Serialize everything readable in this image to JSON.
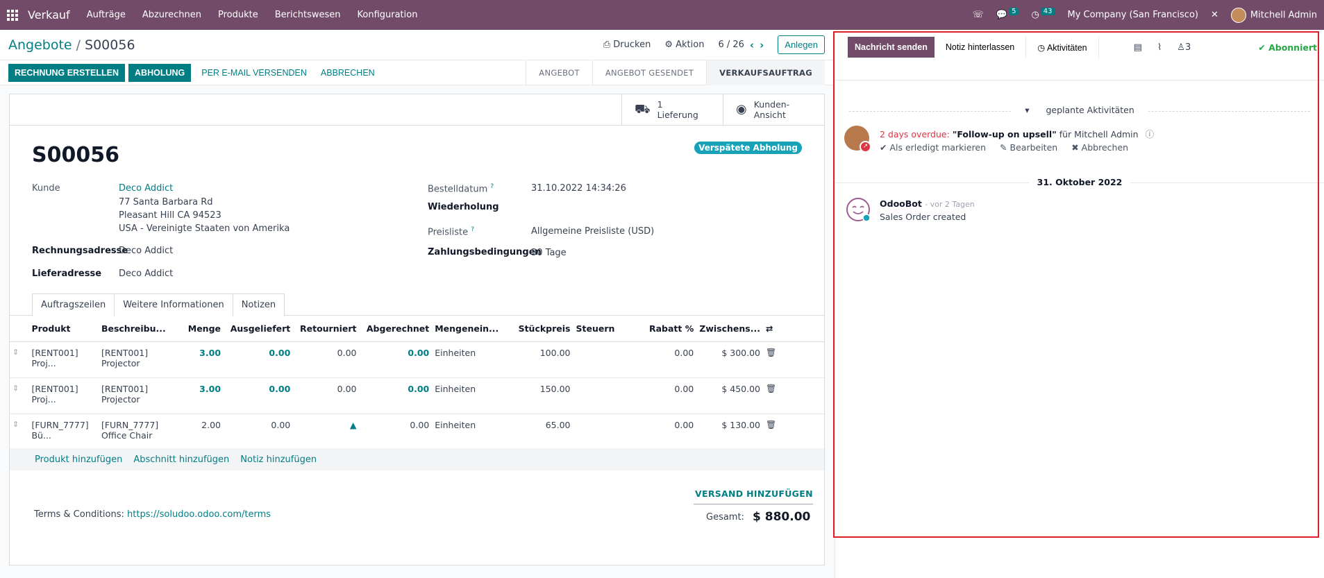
{
  "topnav": {
    "app_name": "Verkauf",
    "menu": [
      "Aufträge",
      "Abzurechnen",
      "Produkte",
      "Berichtswesen",
      "Konfiguration"
    ],
    "messages_count": "5",
    "activities_count": "43",
    "company": "My Company (San Francisco)",
    "user": "Mitchell Admin"
  },
  "control_panel": {
    "breadcrumb_parent": "Angebote",
    "breadcrumb_sep": "/",
    "breadcrumb_current": "S00056",
    "print": "Drucken",
    "action": "Aktion",
    "pager": "6 / 26",
    "new": "Anlegen"
  },
  "statusbar": {
    "buttons": {
      "invoice": "RECHNUNG ERSTELLEN",
      "pickup": "ABHOLUNG",
      "email": "PER E-MAIL VERSENDEN",
      "cancel": "ABBRECHEN"
    },
    "stages": [
      "ANGEBOT",
      "ANGEBOT GESENDET",
      "VERKAUFSAUFTRAG"
    ]
  },
  "smart_buttons": {
    "delivery_count": "1",
    "delivery_label": "Lieferung",
    "portal_line1": "Kunden-",
    "portal_line2": "Ansicht"
  },
  "order": {
    "name": "S00056",
    "late_badge": "Verspätete Abholung",
    "customer_label": "Kunde",
    "customer": "Deco Addict",
    "address1": "77 Santa Barbara Rd",
    "address2": "Pleasant Hill CA 94523",
    "address3": "USA - Vereinigte Staaten von Amerika",
    "invoice_addr_label": "Rechnungsadresse",
    "invoice_addr": "Deco Addict",
    "delivery_addr_label": "Lieferadresse",
    "delivery_addr": "Deco Addict",
    "order_date_label": "Bestelldatum",
    "order_date": "31.10.2022 14:34:26",
    "recurrence_label": "Wiederholung",
    "pricelist_label": "Preisliste",
    "pricelist": "Allgemeine Preisliste (USD)",
    "payment_terms_label": "Zahlungsbedingungen",
    "payment_terms": "30 Tage",
    "help_mark": "?"
  },
  "tabs": [
    "Auftragszeilen",
    "Weitere Informationen",
    "Notizen"
  ],
  "lines": {
    "headers": [
      "Produkt",
      "Beschreibu...",
      "Menge",
      "Ausgeliefert",
      "Retourniert",
      "Abgerechnet",
      "Mengenein...",
      "Stückpreis",
      "Steuern",
      "Rabatt %",
      "Zwischens..."
    ],
    "rows": [
      {
        "product": "[RENT001] Proj...",
        "desc1": "[RENT001]",
        "desc2": "Projector",
        "qty": "3.00",
        "delivered": "0.00",
        "returned": "0.00",
        "invoiced": "0.00",
        "uom": "Einheiten",
        "price": "100.00",
        "taxes": "",
        "discount": "0.00",
        "subtotal": "$ 300.00"
      },
      {
        "product": "[RENT001] Proj...",
        "desc1": "[RENT001]",
        "desc2": "Projector",
        "qty": "3.00",
        "delivered": "0.00",
        "returned": "0.00",
        "invoiced": "0.00",
        "uom": "Einheiten",
        "price": "150.00",
        "taxes": "",
        "discount": "0.00",
        "subtotal": "$ 450.00"
      },
      {
        "product": "[FURN_7777] Bü...",
        "desc1": "[FURN_7777]",
        "desc2": "Office Chair",
        "qty": "2.00",
        "delivered": "0.00",
        "returned": "",
        "invoiced": "0.00",
        "uom": "Einheiten",
        "price": "65.00",
        "taxes": "",
        "discount": "0.00",
        "subtotal": "$ 130.00"
      }
    ],
    "add_product": "Produkt hinzufügen",
    "add_section": "Abschnitt hinzufügen",
    "add_note": "Notiz hinzufügen"
  },
  "footer": {
    "terms_label": "Terms & Conditions:",
    "terms_link": "https://soludoo.odoo.com/terms",
    "add_shipping": "VERSAND HINZUFÜGEN",
    "total_label": "Gesamt:",
    "total_value": "$ 880.00"
  },
  "chatter": {
    "send_message": "Nachricht senden",
    "log_note": "Notiz hinterlassen",
    "activities": "Aktivitäten",
    "followers_count": "3",
    "following": "Abonniert",
    "planned_label": "geplante Aktivitäten",
    "activity": {
      "overdue": "2 days overdue:",
      "summary": "\"Follow-up on upsell\"",
      "for_label": "für",
      "assignee": "Mitchell Admin",
      "mark_done": "Als erledigt markieren",
      "edit": "Bearbeiten",
      "cancel": "Abbrechen"
    },
    "date_separator": "31. Oktober 2022",
    "message": {
      "author": "OdooBot",
      "time": "- vor 2 Tagen",
      "body": "Sales Order created"
    }
  },
  "colors": {
    "brand": "#714b67",
    "primary": "#017e84",
    "overdue": "#dc3545",
    "highlight_box": "#e11d2a"
  }
}
